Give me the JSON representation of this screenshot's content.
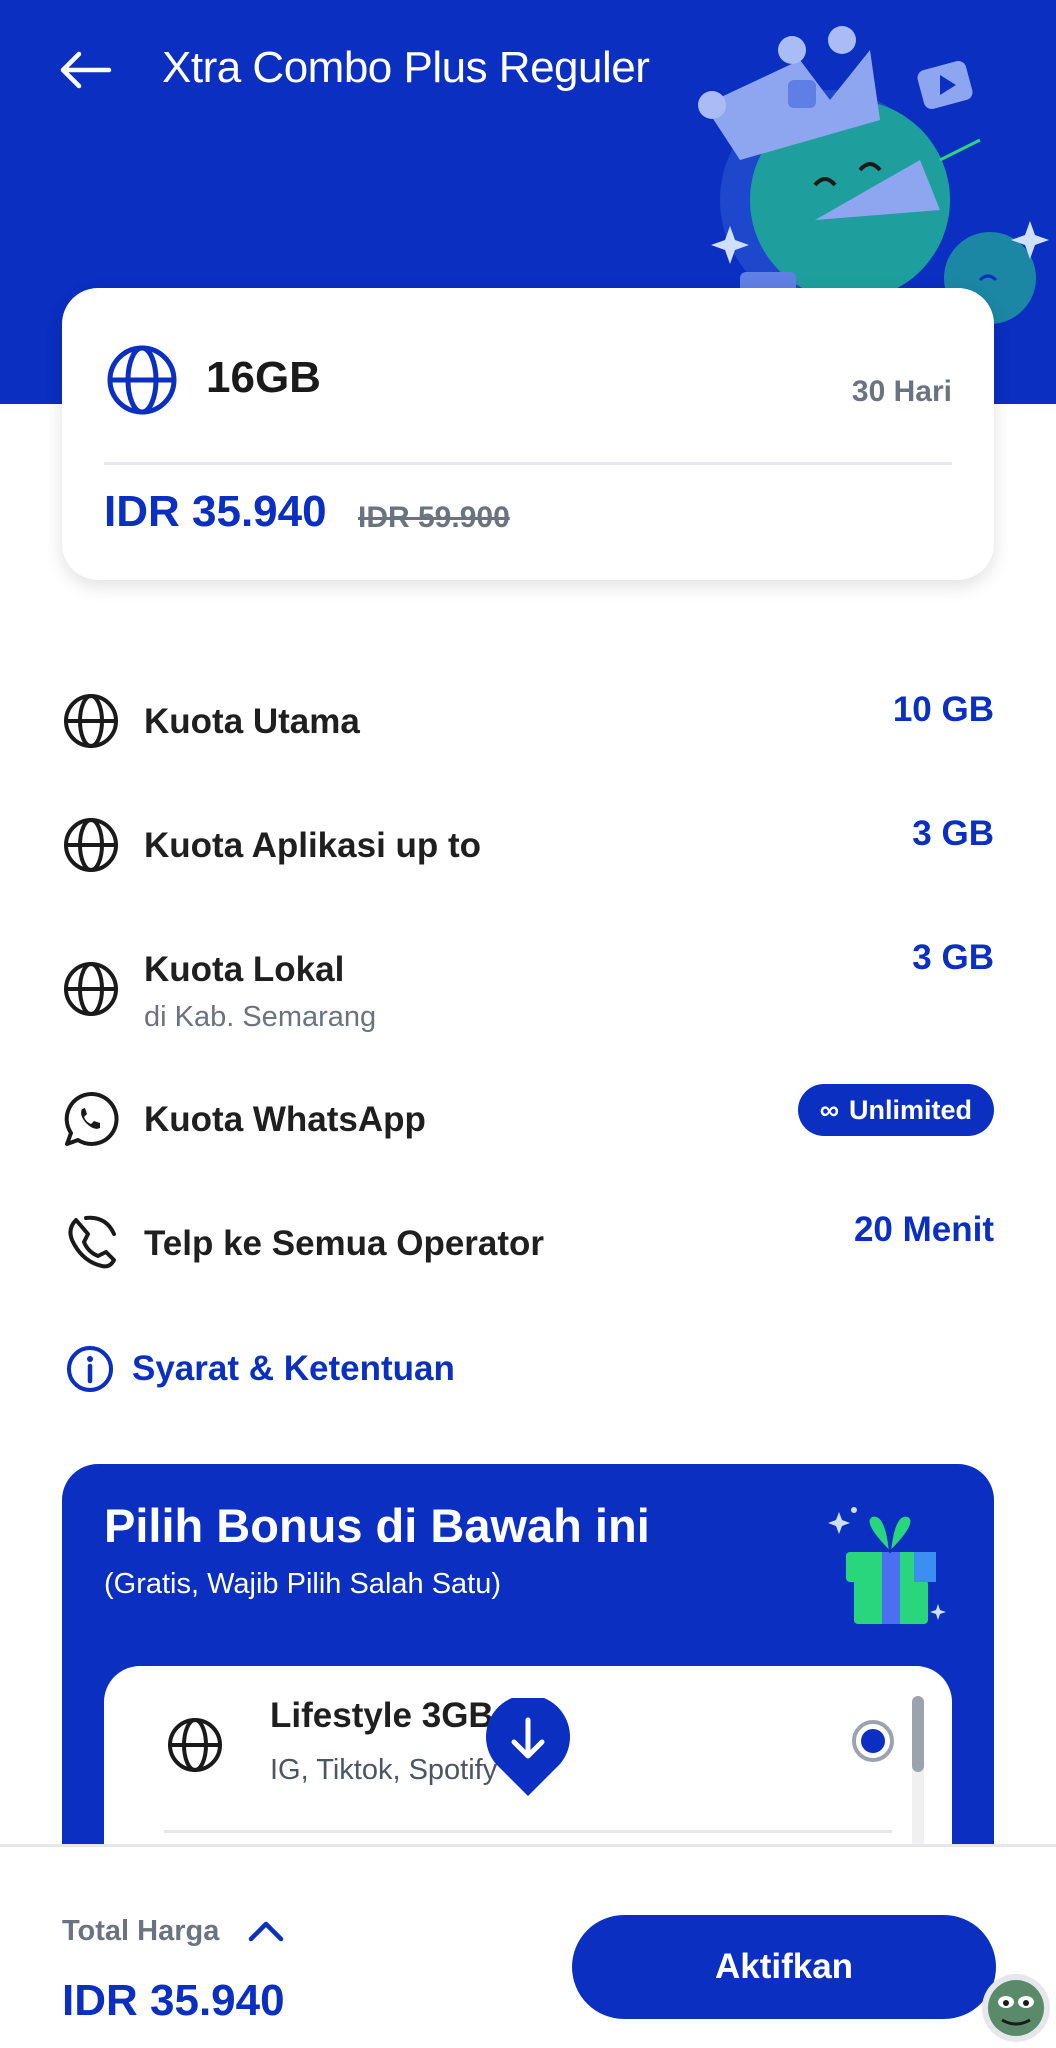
{
  "header": {
    "title": "Xtra Combo Plus Reguler",
    "back_icon": "arrow-left-icon",
    "background_color": "#0a2fc1"
  },
  "package": {
    "icon": "globe-icon",
    "name": "16GB",
    "duration": "30 Hari",
    "price": "IDR 35.940",
    "original_price": "IDR 59.900"
  },
  "benefits": [
    {
      "icon": "globe-icon",
      "label": "Kuota Utama",
      "value": "10 GB"
    },
    {
      "icon": "globe-icon",
      "label": "Kuota Aplikasi up to",
      "value": "3 GB"
    },
    {
      "icon": "globe-icon",
      "label": "Kuota Lokal",
      "sublabel": "di Kab. Semarang",
      "value": "3 GB"
    },
    {
      "icon": "whatsapp-icon",
      "label": "Kuota WhatsApp",
      "badge": "Unlimited",
      "badge_symbol": "∞"
    },
    {
      "icon": "phone-icon",
      "label": "Telp ke Semua Operator",
      "value": "20 Menit"
    }
  ],
  "terms": {
    "icon": "info-icon",
    "label": "Syarat & Ketentuan"
  },
  "bonus": {
    "title": "Pilih Bonus di Bawah ini",
    "subtitle": "(Gratis, Wajib Pilih Salah Satu)",
    "gift_icon": "gift-icon",
    "options": [
      {
        "icon": "globe-icon",
        "title": "Lifestyle 3GB",
        "description": "IG, Tiktok, Spotify",
        "selected": true
      }
    ]
  },
  "footer": {
    "total_label": "Total Harga",
    "total_price": "IDR 35.940",
    "activate_label": "Aktifkan"
  },
  "colors": {
    "brand_blue": "#0a2fc1",
    "muted_gray": "#6b7280"
  }
}
